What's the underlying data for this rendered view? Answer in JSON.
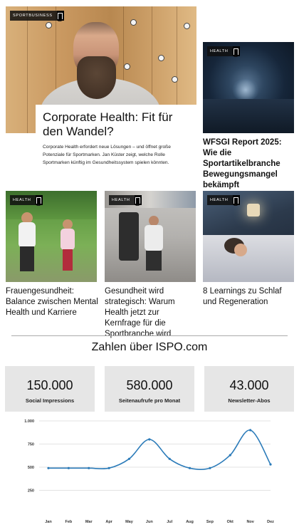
{
  "hero": {
    "tag": "SPORTBUSINESS",
    "title": "Corporate Health: Fit für den Wandel?",
    "description": "Corporate Health erfordert neue Lösungen – und öffnet große Potenziale für Sportmarken. Jan Küster zeigt, welche Rolle Sportmarken künftig im Gesundheitssystem spielen könnten."
  },
  "side_article": {
    "tag": "HEALTH",
    "title": "WFSGI Report 2025: Wie die Sportartikelbranche Bewegungsmangel bekämpft"
  },
  "articles": [
    {
      "tag": "HEALTH",
      "title": "Frauengesundheit: Balance zwischen Mental Health und Karriere"
    },
    {
      "tag": "HEALTH",
      "title": "Gesundheit wird strategisch: Warum Health jetzt zur Kernfrage für die Sportbranche wird"
    },
    {
      "tag": "HEALTH",
      "title": "8 Learnings zu Schlaf und Regeneration"
    }
  ],
  "stats": {
    "title": "Zahlen über ISPO.com",
    "items": [
      {
        "value": "150.000",
        "label": "Social Impressions"
      },
      {
        "value": "580.000",
        "label": "Seitenaufrufe pro Monat"
      },
      {
        "value": "43.000",
        "label": "Newsletter-Abos"
      }
    ]
  },
  "chart_data": {
    "type": "line",
    "categories": [
      "Jan",
      "Feb",
      "Mar",
      "Apr",
      "May",
      "Jun",
      "Jul",
      "Aug",
      "Sep",
      "Okt",
      "Nov",
      "Dez"
    ],
    "values": [
      490,
      490,
      490,
      490,
      590,
      800,
      590,
      490,
      490,
      630,
      900,
      530
    ],
    "ylim": [
      0,
      1000
    ],
    "yticks": [
      250,
      500,
      750,
      1000
    ],
    "ytick_labels": [
      "250",
      "500",
      "750",
      "1.000"
    ],
    "color": "#2b7bb9",
    "grid": true
  }
}
